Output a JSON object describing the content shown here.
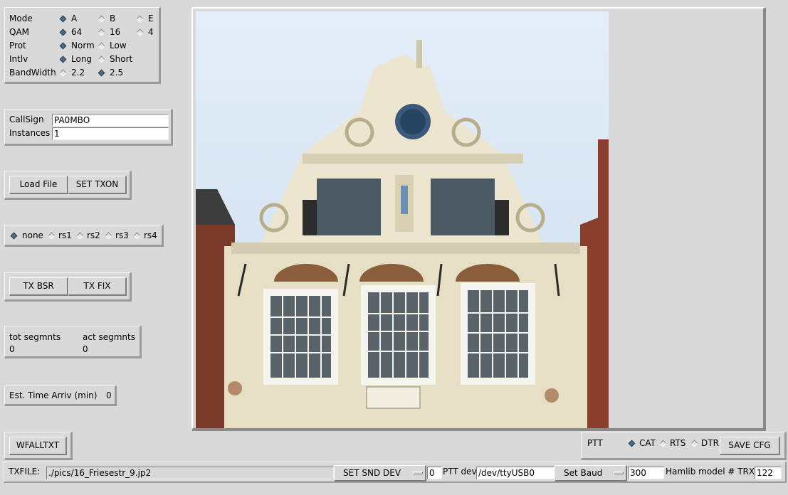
{
  "mode_panel": {
    "rows": [
      {
        "label": "Mode",
        "options": [
          "A",
          "B",
          "E"
        ],
        "selected": 0
      },
      {
        "label": "QAM",
        "options": [
          "64",
          "16",
          "4"
        ],
        "selected": 0
      },
      {
        "label": "Prot",
        "options": [
          "Norm",
          "Low"
        ],
        "selected": 0
      },
      {
        "label": "Intlv",
        "options": [
          "Long",
          "Short"
        ],
        "selected": 0
      },
      {
        "label": "BandWidth",
        "options": [
          "2.2",
          "2.5"
        ],
        "selected": 1
      }
    ]
  },
  "callsign_panel": {
    "callsign_label": "CallSign",
    "callsign_value": "PA0MBO",
    "instances_label": "Instances",
    "instances_value": "1"
  },
  "file_buttons": {
    "load_file": "Load File",
    "set_txon": "SET TXON"
  },
  "rs_panel": {
    "options": [
      "none",
      "rs1",
      "rs2",
      "rs3",
      "rs4"
    ],
    "selected": 0
  },
  "tx_buttons": {
    "tx_bsr": "TX BSR",
    "tx_fix": "TX FIX"
  },
  "segments": {
    "tot_label": "tot segmnts",
    "tot_value": "0",
    "act_label": "act segmnts",
    "act_value": "0"
  },
  "eta": {
    "label": "Est. Time Arriv (min)",
    "value": "0"
  },
  "waterfall": {
    "button": "WFALLTXT"
  },
  "ptt": {
    "label": "PTT",
    "options": [
      "CAT",
      "RTS",
      "DTR"
    ],
    "selected": 0,
    "save_cfg": "SAVE CFG"
  },
  "bottom_bar": {
    "txfile_label": "TXFILE:",
    "txfile_value": "./pics/16_Friesestr_9.jp2",
    "set_snd_dev": "SET SND DEV",
    "snd_dev_value": "0",
    "ptt_dev_label": "PTT dev",
    "ptt_dev_value": "/dev/ttyUSB0",
    "set_baud": "Set Baud",
    "baud_value": "300",
    "hamlib_label": "Hamlib model # TRX",
    "hamlib_value": "122"
  },
  "colors": {
    "background": "#d9d9d9",
    "radio_selected": "#4f6b86",
    "sky": "#dfeaf4",
    "facade": "#e8e2cc"
  }
}
